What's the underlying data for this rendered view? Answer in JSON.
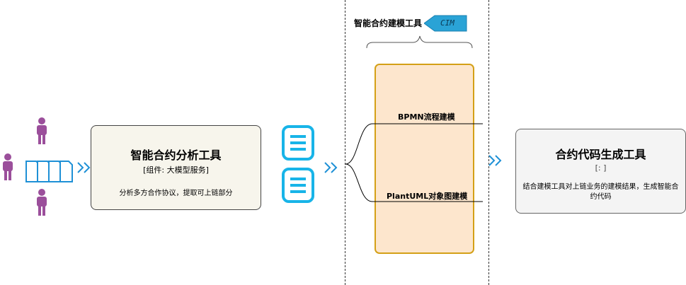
{
  "analysis_tool": {
    "title": "智能合约分析工具",
    "subtitle": "[组件: 大模型服务]",
    "description": "分析多方合作协议，提取可上链部分"
  },
  "modeling_tool": {
    "header": "智能合约建模工具",
    "tag": "CIM",
    "bpmn_label": "BPMN流程建模",
    "plantuml_label": "PlantUML对象图建模"
  },
  "codegen_tool": {
    "title": "合约代码生成工具",
    "subtitle": "[: ]",
    "description": "结合建模工具对上链业务的建模结果，生成智能合约代码"
  },
  "colors": {
    "person": "#9b4f9b",
    "doc": "#1e90d6",
    "arrow": "#1e90d6",
    "analysis_box_bg": "#f7f5ec",
    "modeling_box_bg": "#fde6cd",
    "modeling_box_border": "#d4a017",
    "codegen_box_bg": "#f4f4f4",
    "tag_bg": "#2aa3d6"
  }
}
